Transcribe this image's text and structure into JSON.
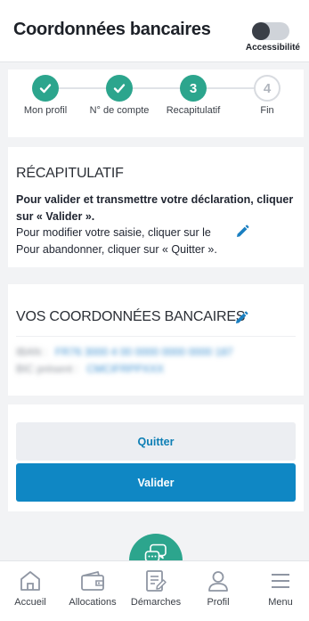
{
  "header": {
    "title": "Coordonnées bancaires",
    "accessibility_label": "Accessibilité",
    "accessibility_enabled": false
  },
  "stepper": {
    "steps": [
      {
        "number": "1",
        "label": "Mon profil",
        "state": "done"
      },
      {
        "number": "2",
        "label": "N° de compte",
        "state": "done"
      },
      {
        "number": "3",
        "label": "Recapitulatif",
        "state": "active"
      },
      {
        "number": "4",
        "label": "Fin",
        "state": "todo"
      }
    ]
  },
  "recap": {
    "title": "RÉCAPITULATIF",
    "line1": "Pour valider et transmettre votre déclaration, cliquer sur « Valider ».",
    "line2": "Pour modifier votre saisie, cliquer sur le",
    "line3": "Pour abandonner, cliquer sur « Quitter »."
  },
  "coords": {
    "title": "VOS COORDONNÉES BANCAIRES",
    "rows": [
      {
        "label": "IBAN :",
        "value": "FR76 3000 4 00 0000 0000 0000 187"
      },
      {
        "label": "BIC présent :",
        "value": "CMCIFRPPXXX"
      }
    ]
  },
  "actions": {
    "quit_label": "Quitter",
    "validate_label": "Valider"
  },
  "nav": {
    "items": [
      {
        "label": "Accueil",
        "icon": "home-icon"
      },
      {
        "label": "Allocations",
        "icon": "wallet-icon"
      },
      {
        "label": "Démarches",
        "icon": "document-edit-icon"
      },
      {
        "label": "Profil",
        "icon": "user-icon"
      },
      {
        "label": "Menu",
        "icon": "menu-icon"
      }
    ]
  },
  "colors": {
    "accent_green": "#2ca58d",
    "primary_blue": "#0f87c4",
    "link_blue": "#0e7fb5"
  }
}
